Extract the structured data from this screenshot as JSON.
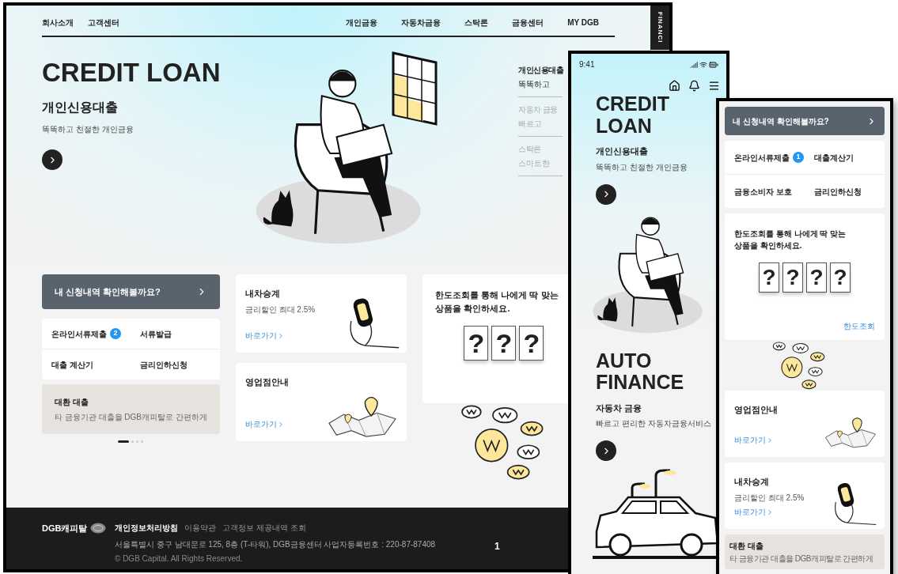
{
  "desktop": {
    "top_links": [
      "회사소개",
      "고객센터"
    ],
    "nav": [
      "개인금융",
      "자동차금융",
      "스탁론",
      "금융센터",
      "MY DGB"
    ],
    "side_tab": "FINANCI",
    "hero": {
      "title": "CREDIT LOAN",
      "subtitle": "개인신용대출",
      "desc": "똑똑하고 친절한 개인금융"
    },
    "product_menu": [
      {
        "title": "개인신용대출",
        "desc": "똑똑하고",
        "selected": true
      },
      {
        "title": "자동차 금융",
        "desc": "빠르고",
        "selected": false
      },
      {
        "title": "스탁론",
        "desc": "스마트한",
        "selected": false
      }
    ],
    "apply_button": "내 신청내역 확인해볼까요?",
    "quick_links": [
      {
        "label": "온라인서류제출",
        "badge": "2"
      },
      {
        "label": "서류발급"
      },
      {
        "label": "대출 계산기"
      },
      {
        "label": "금리인하신청"
      }
    ],
    "refinance": {
      "title": "대환 대출",
      "desc": "타 금융기관 대출을 DGB캐피탈로 간편하게"
    },
    "pager": [
      {
        "selected": true
      },
      {
        "selected": false
      },
      {
        "selected": false
      },
      {
        "selected": false
      }
    ],
    "cards": [
      {
        "kind": "car",
        "title": "내차승계",
        "desc": "금리할인 최대 2.5%",
        "link": "바로가기"
      },
      {
        "kind": "branch",
        "title": "영업점안내",
        "link": "바로가기"
      }
    ],
    "limit": {
      "text": "한도조회를 통해 나에게 딱 맞는 상품을 확인하세요.",
      "slots": [
        "?",
        "?",
        "?"
      ]
    },
    "footer": {
      "logo": "DGB캐피탈",
      "links": [
        "개인정보처리방침",
        "이용약관",
        "고객정보 제공내역 조회"
      ],
      "address": "서울특별시 중구 남대문로 125, 8층 (T-타워), DGB금융센터  사업자등록번호 : 220-87-87408",
      "copyright": "© DGB Capital. All Rights Reserved.",
      "page_marker": "1"
    }
  },
  "phone_main": {
    "time": "9:41",
    "sections": [
      {
        "kind": "credit",
        "title": "CREDIT LOAN",
        "subtitle": "개인신용대출",
        "desc": "똑똑하고 친절한 개인금융"
      },
      {
        "kind": "auto",
        "title": "AUTO FINANCE",
        "subtitle": "자동차 금융",
        "desc": "빠르고 편리한 자동차금융서비스"
      }
    ]
  },
  "phone_detail": {
    "apply_button": "내 신청내역 확인해볼까요?",
    "quick_links": [
      {
        "label": "온라인서류제출",
        "badge": "1"
      },
      {
        "label": "대출계산기"
      },
      {
        "label": "금융소비자 보호"
      },
      {
        "label": "금리인하신청"
      }
    ],
    "limit": {
      "text": "한도조회를 통해 나에게 딱 맞는 상품을 확인하세요.",
      "slots": [
        "?",
        "?",
        "?",
        "?"
      ],
      "link": "한도조회"
    },
    "cards": [
      {
        "kind": "branch",
        "title": "영업점안내",
        "link": "바로가기"
      },
      {
        "kind": "car",
        "title": "내차승계",
        "desc": "금리할인 최대 2.5%",
        "link": "바로가기"
      }
    ],
    "refinance": {
      "title": "대환 대출",
      "desc": "타 금융기관 대출을 DGB캐피탈로 간편하게"
    }
  }
}
